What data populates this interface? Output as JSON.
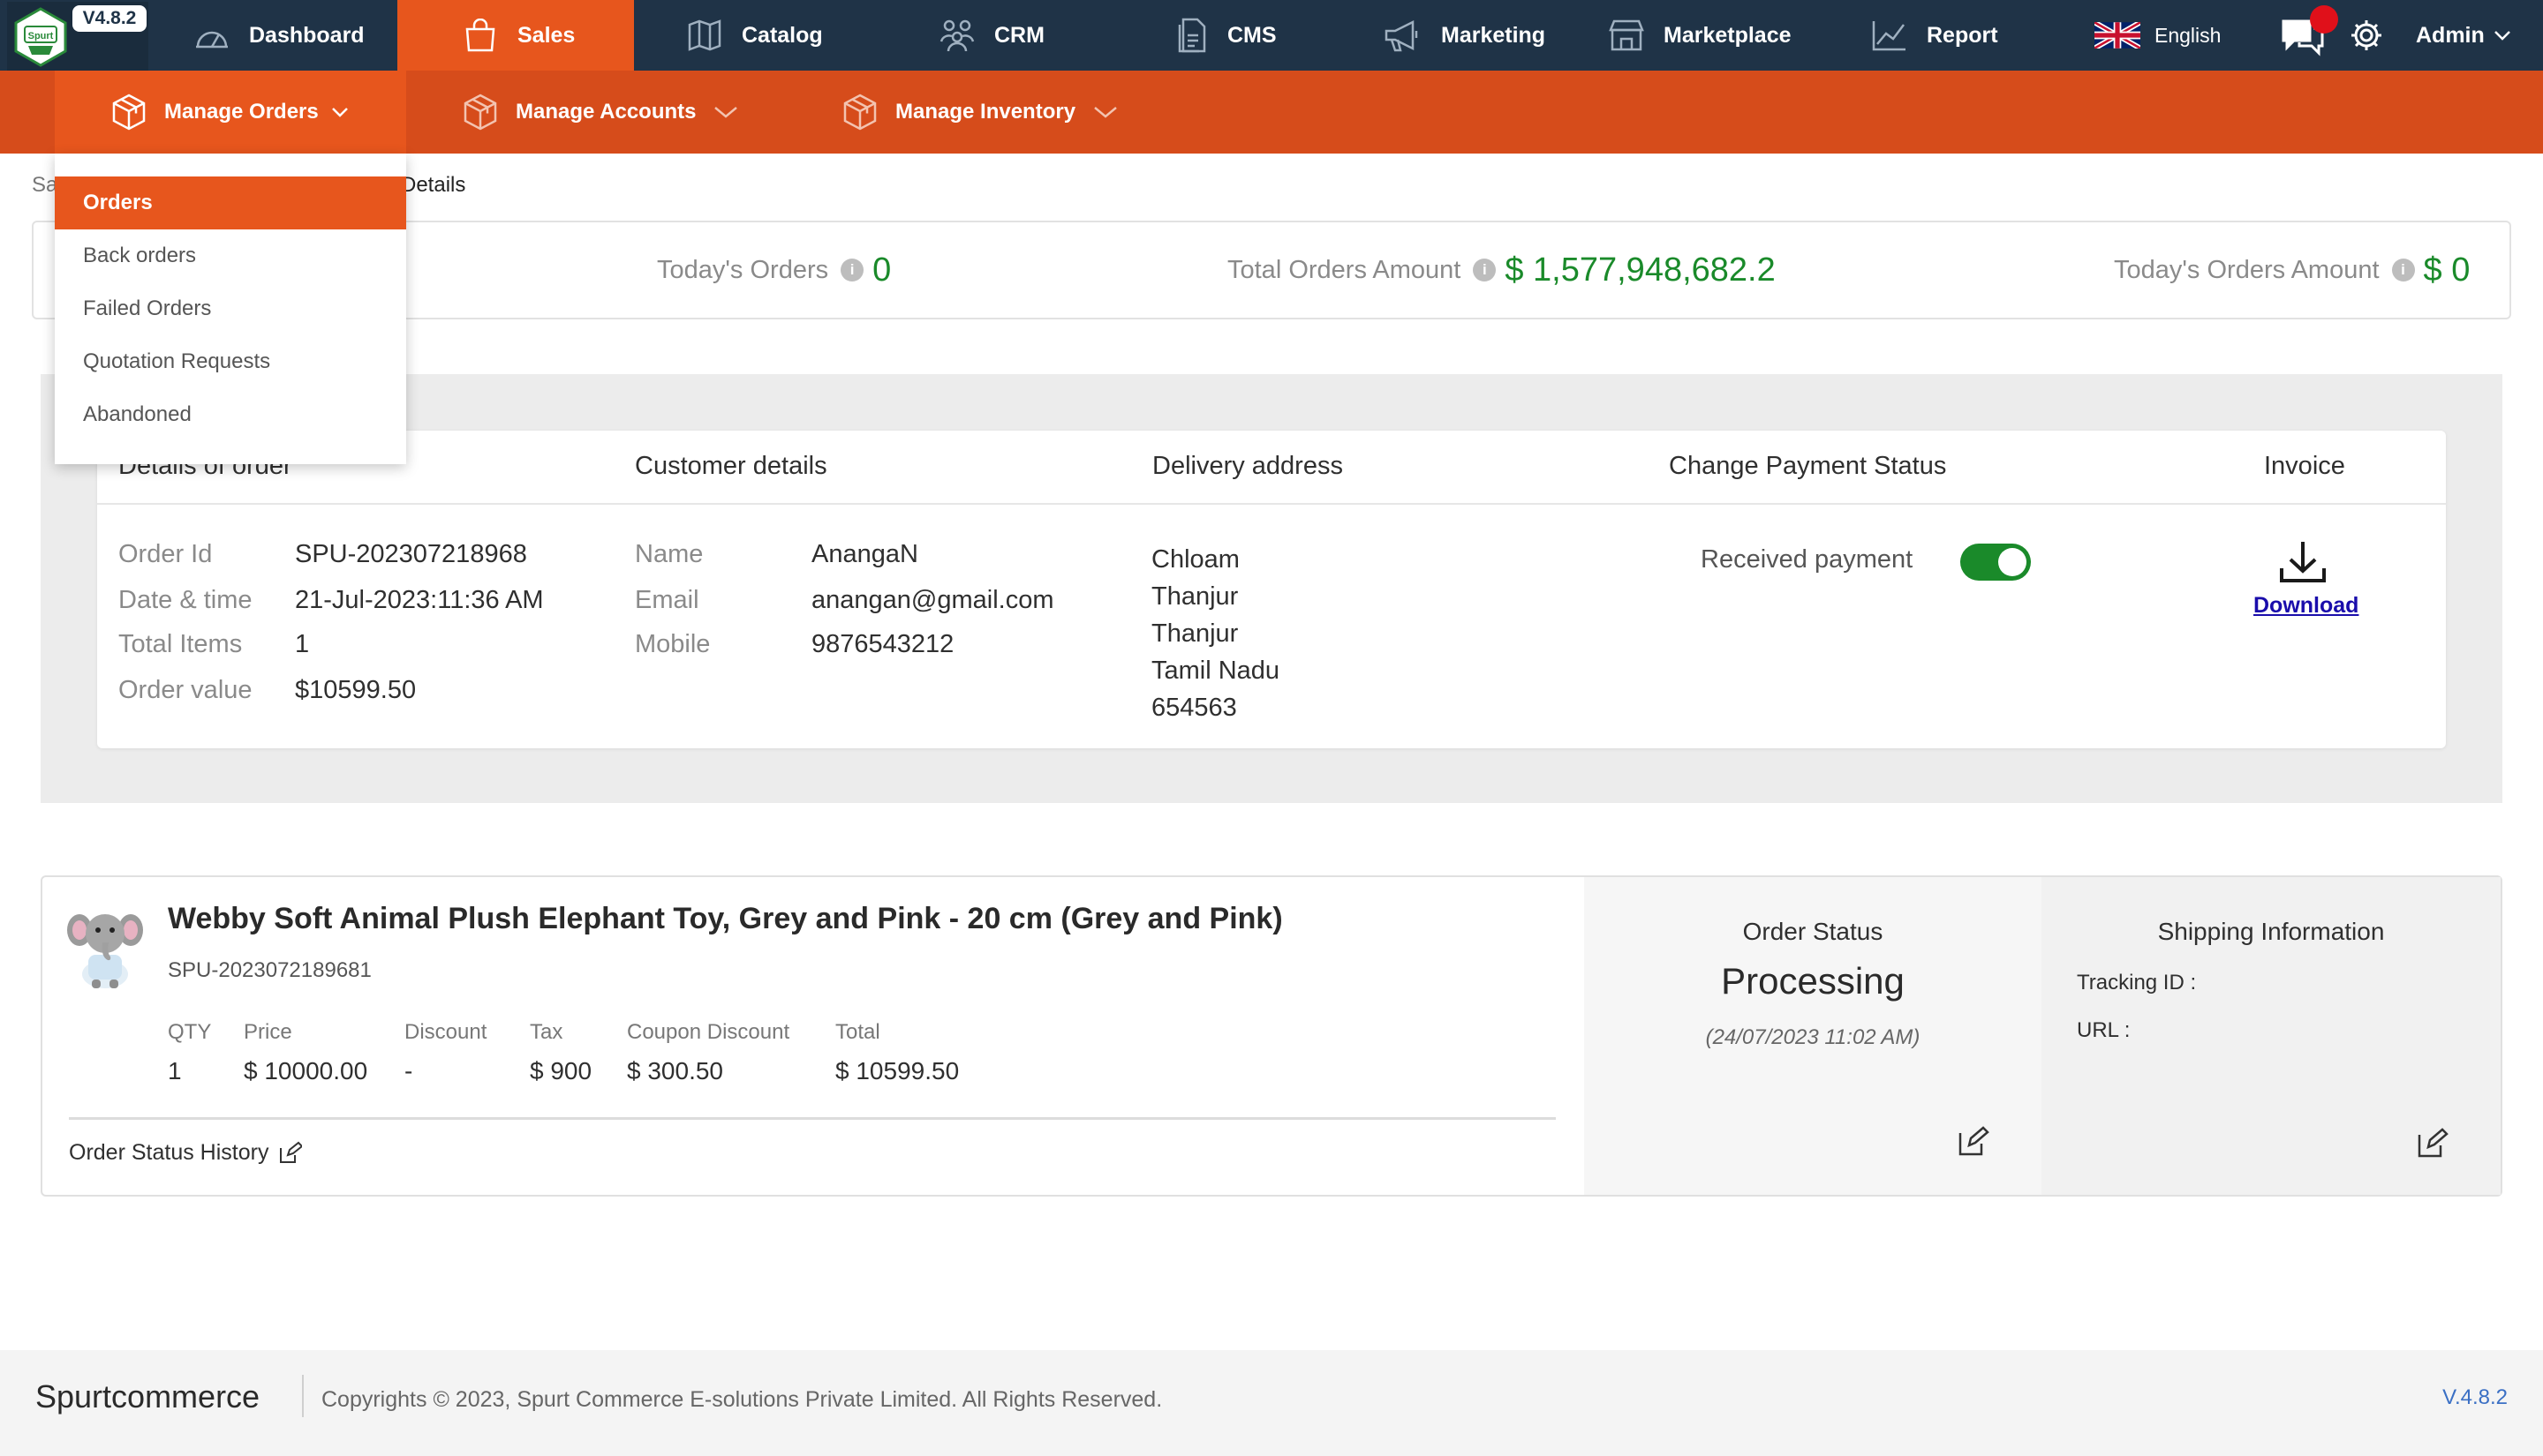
{
  "app": {
    "version_badge": "V4.8.2",
    "logo_text": "Spurt"
  },
  "topnav": {
    "items": [
      {
        "label": "Dashboard",
        "icon": "dashboard-gauge-icon"
      },
      {
        "label": "Sales",
        "icon": "shopping-bag-icon"
      },
      {
        "label": "Catalog",
        "icon": "map-icon"
      },
      {
        "label": "CRM",
        "icon": "users-icon"
      },
      {
        "label": "CMS",
        "icon": "document-icon"
      },
      {
        "label": "Marketing",
        "icon": "megaphone-icon"
      },
      {
        "label": "Marketplace",
        "icon": "store-icon"
      },
      {
        "label": "Report",
        "icon": "line-chart-icon"
      }
    ],
    "language": "English",
    "user": "Admin"
  },
  "subnav": {
    "items": [
      {
        "label": "Manage Orders"
      },
      {
        "label": "Manage Accounts"
      },
      {
        "label": "Manage Inventory"
      }
    ]
  },
  "dropdown": {
    "items": [
      "Orders",
      "Back orders",
      "Failed Orders",
      "Quotation Requests",
      "Abandoned"
    ]
  },
  "breadcrumb": {
    "first": "Sa",
    "current": "Details"
  },
  "stats": {
    "todays_orders_label": "Today's Orders",
    "todays_orders_value": "0",
    "total_amount_label": "Total Orders Amount",
    "total_amount_value": "$ 1,577,948,682.2",
    "todays_amount_label": "Today's Orders Amount",
    "todays_amount_value": "$ 0"
  },
  "details": {
    "headers": {
      "order": "Details of order",
      "customer": "Customer details",
      "delivery": "Delivery address",
      "payment": "Change Payment Status",
      "invoice": "Invoice"
    },
    "order": {
      "id_label": "Order Id",
      "id": "SPU-202307218968",
      "date_label": "Date & time",
      "date": "21-Jul-2023:11:36 AM",
      "items_label": "Total Items",
      "items": "1",
      "value_label": "Order value",
      "value": "$10599.50"
    },
    "customer": {
      "name_label": "Name",
      "name": "AnangaN",
      "email_label": "Email",
      "email": "anangan@gmail.com",
      "mobile_label": "Mobile",
      "mobile": "9876543212"
    },
    "address": [
      "Chloam",
      "Thanjur",
      "Thanjur",
      "Tamil Nadu",
      "654563"
    ],
    "payment": {
      "label": "Received payment",
      "received": true
    },
    "invoice": {
      "link": "Download"
    }
  },
  "product": {
    "title": "Webby Soft Animal Plush Elephant Toy, Grey and Pink - 20 cm (Grey and Pink)",
    "sku": "SPU-2023072189681",
    "columns": [
      "QTY",
      "Price",
      "Discount",
      "Tax",
      "Coupon Discount",
      "Total"
    ],
    "values": [
      "1",
      "$ 10000.00",
      "-",
      "$ 900",
      "$ 300.50",
      "$ 10599.50"
    ],
    "history_label": "Order Status History"
  },
  "order_status": {
    "heading": "Order Status",
    "status": "Processing",
    "date": "(24/07/2023 11:02 AM)"
  },
  "shipping": {
    "heading": "Shipping Information",
    "tracking_label": "Tracking ID :",
    "url_label": "URL :"
  },
  "footer": {
    "brand": "Spurtcommerce",
    "copyright": "Copyrights © 2023, Spurt Commerce E-solutions Private Limited. All Rights Reserved.",
    "version": "V.4.8.2"
  },
  "colors": {
    "nav_bg": "#1f3347",
    "accent": "#e7561d",
    "subnav_bg": "#d64c1b",
    "success": "#1a8a2a"
  }
}
